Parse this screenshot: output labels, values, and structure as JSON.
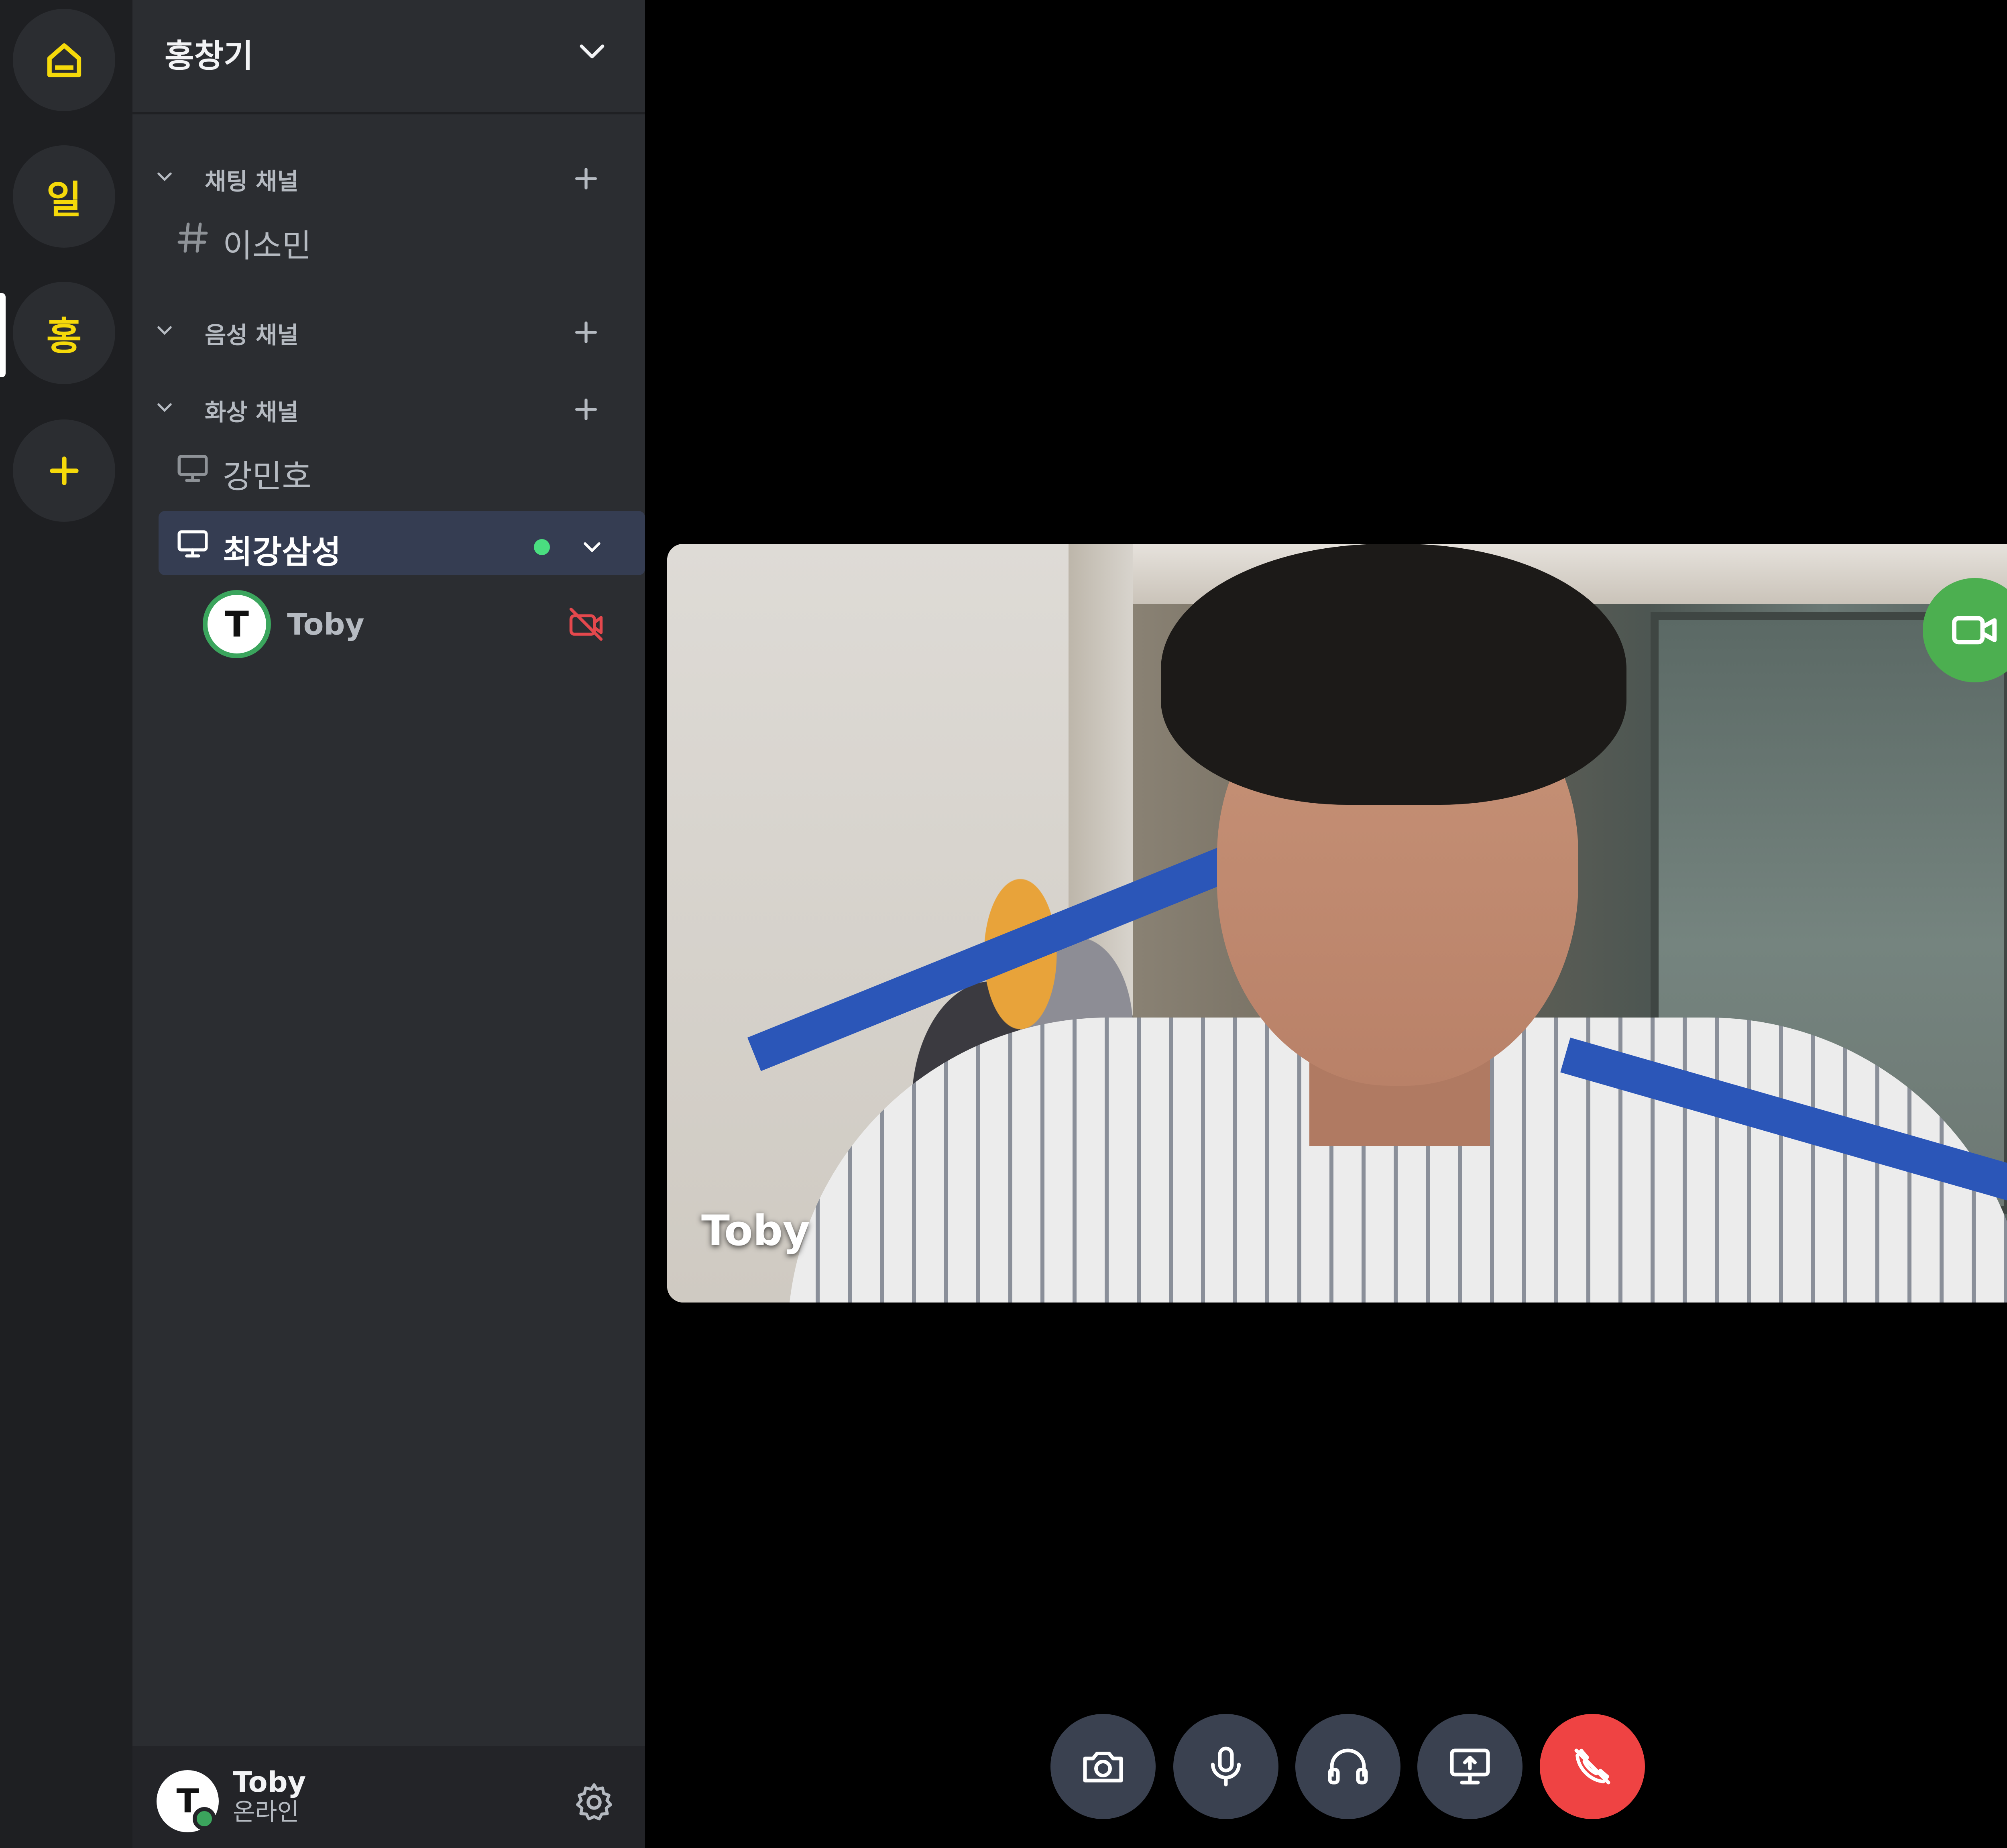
{
  "servers": [
    {
      "label": "",
      "icon": "home-icon"
    },
    {
      "label": "일"
    },
    {
      "label": "홍"
    },
    {
      "label": "+",
      "icon": "plus-icon"
    }
  ],
  "sidebar": {
    "server_name": "홍창기",
    "categories": {
      "chat": {
        "label": "채팅 채널"
      },
      "voice": {
        "label": "음성 채널"
      },
      "video": {
        "label": "화상 채널"
      }
    },
    "channels": {
      "chat_0": {
        "label": "이소민",
        "icon": "hash-icon"
      },
      "video_0": {
        "label": "강민호",
        "icon": "monitor-icon"
      },
      "video_1": {
        "label": "최강삼성",
        "icon": "monitor-icon",
        "active": true
      }
    },
    "member": {
      "name": "Toby",
      "avatar_initial": "T",
      "camera": "camera-off-icon"
    }
  },
  "user_panel": {
    "name": "Toby",
    "status": "온라인",
    "avatar_initial": "T"
  },
  "video": {
    "participant_name": "Toby"
  },
  "controls": [
    "camera-icon",
    "microphone-icon",
    "headphones-icon",
    "screen-share-icon",
    "hang-up-icon"
  ],
  "colors": {
    "accent_yellow": "#f5d90a",
    "online_green": "#3ba55d",
    "active_dot": "#4ade80",
    "video_badge": "#4caf50",
    "hangup_red": "#ef4343",
    "camera_off_red": "#e5484d"
  }
}
